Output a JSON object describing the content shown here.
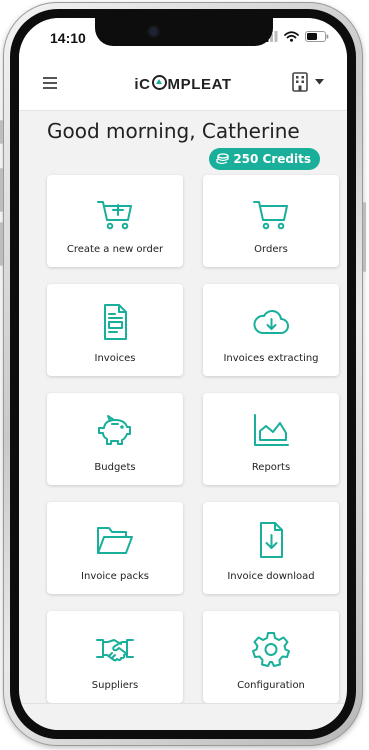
{
  "status_bar": {
    "time": "14:10"
  },
  "app": {
    "logo_text_left": "iC",
    "logo_text_right": "MPLEAT"
  },
  "greeting": "Good morning, Catherine",
  "credits_label": "250 Credits",
  "accent_color": "#1aaf9a",
  "tiles": [
    {
      "label": "Create a new order",
      "icon": "cart-plus-icon"
    },
    {
      "label": "Orders",
      "icon": "cart-icon"
    },
    {
      "label": "Invoices",
      "icon": "invoice-document-icon"
    },
    {
      "label": "Invoices extracting",
      "icon": "cloud-download-icon"
    },
    {
      "label": "Budgets",
      "icon": "piggy-bank-icon"
    },
    {
      "label": "Reports",
      "icon": "area-chart-icon"
    },
    {
      "label": "Invoice packs",
      "icon": "open-folder-icon"
    },
    {
      "label": "Invoice download",
      "icon": "file-download-icon"
    },
    {
      "label": "Suppliers",
      "icon": "handshake-icon"
    },
    {
      "label": "Configuration",
      "icon": "gear-icon"
    }
  ]
}
